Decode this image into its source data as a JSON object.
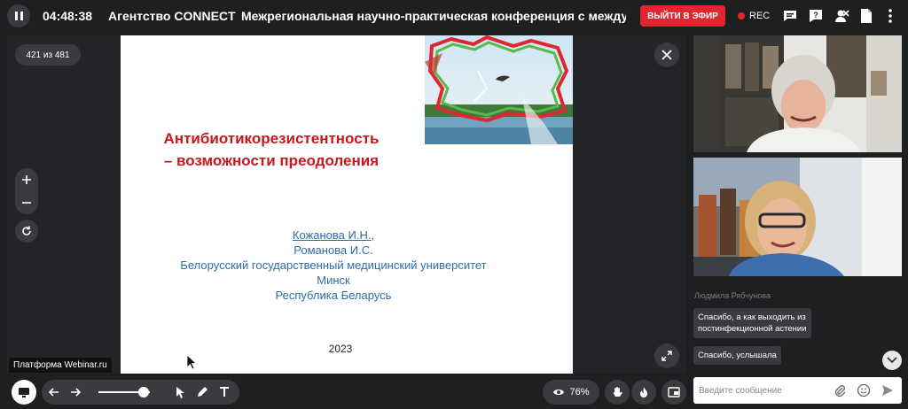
{
  "header": {
    "timer": "04:48:38",
    "organizer": "Агентство CONNECT",
    "event_title": "Межрегиональная научно-практическая конференция с междуна",
    "go_live_label": "ВЫЙТИ В ЭФИР",
    "rec_label": "REC",
    "icons": [
      "chat-icon",
      "help-icon",
      "user-off-icon",
      "document-icon",
      "more-vertical-icon"
    ]
  },
  "presentation": {
    "page_counter": "421 из 481",
    "slide": {
      "title_line1": "Антибиотикорезистентность",
      "title_line2": "– возможности преодоления",
      "author1": "Кожанова И.Н.,",
      "author2": "Романова И.С.",
      "institution": "Белорусский государственный медицинский университет",
      "city": "Минск",
      "country": "Республика Беларусь",
      "year": "2023"
    },
    "platform_label": "Платформа Webinar.ru"
  },
  "toolbar": {
    "zoom_level": "76%",
    "slider_fraction": 0.88
  },
  "chat": {
    "sender": "Людмила Рябчунова",
    "messages": [
      {
        "text_line1": "Спасибо, а как выходить из",
        "text_line2": "постинфекционной астении"
      },
      {
        "text_line1": "Спасибо, услышала",
        "text_line2": ""
      }
    ],
    "input_placeholder": "Введите сообщение"
  },
  "colors": {
    "live": "#e0262f",
    "slide_title": "#c8161d",
    "slide_text": "#2e6da8"
  }
}
